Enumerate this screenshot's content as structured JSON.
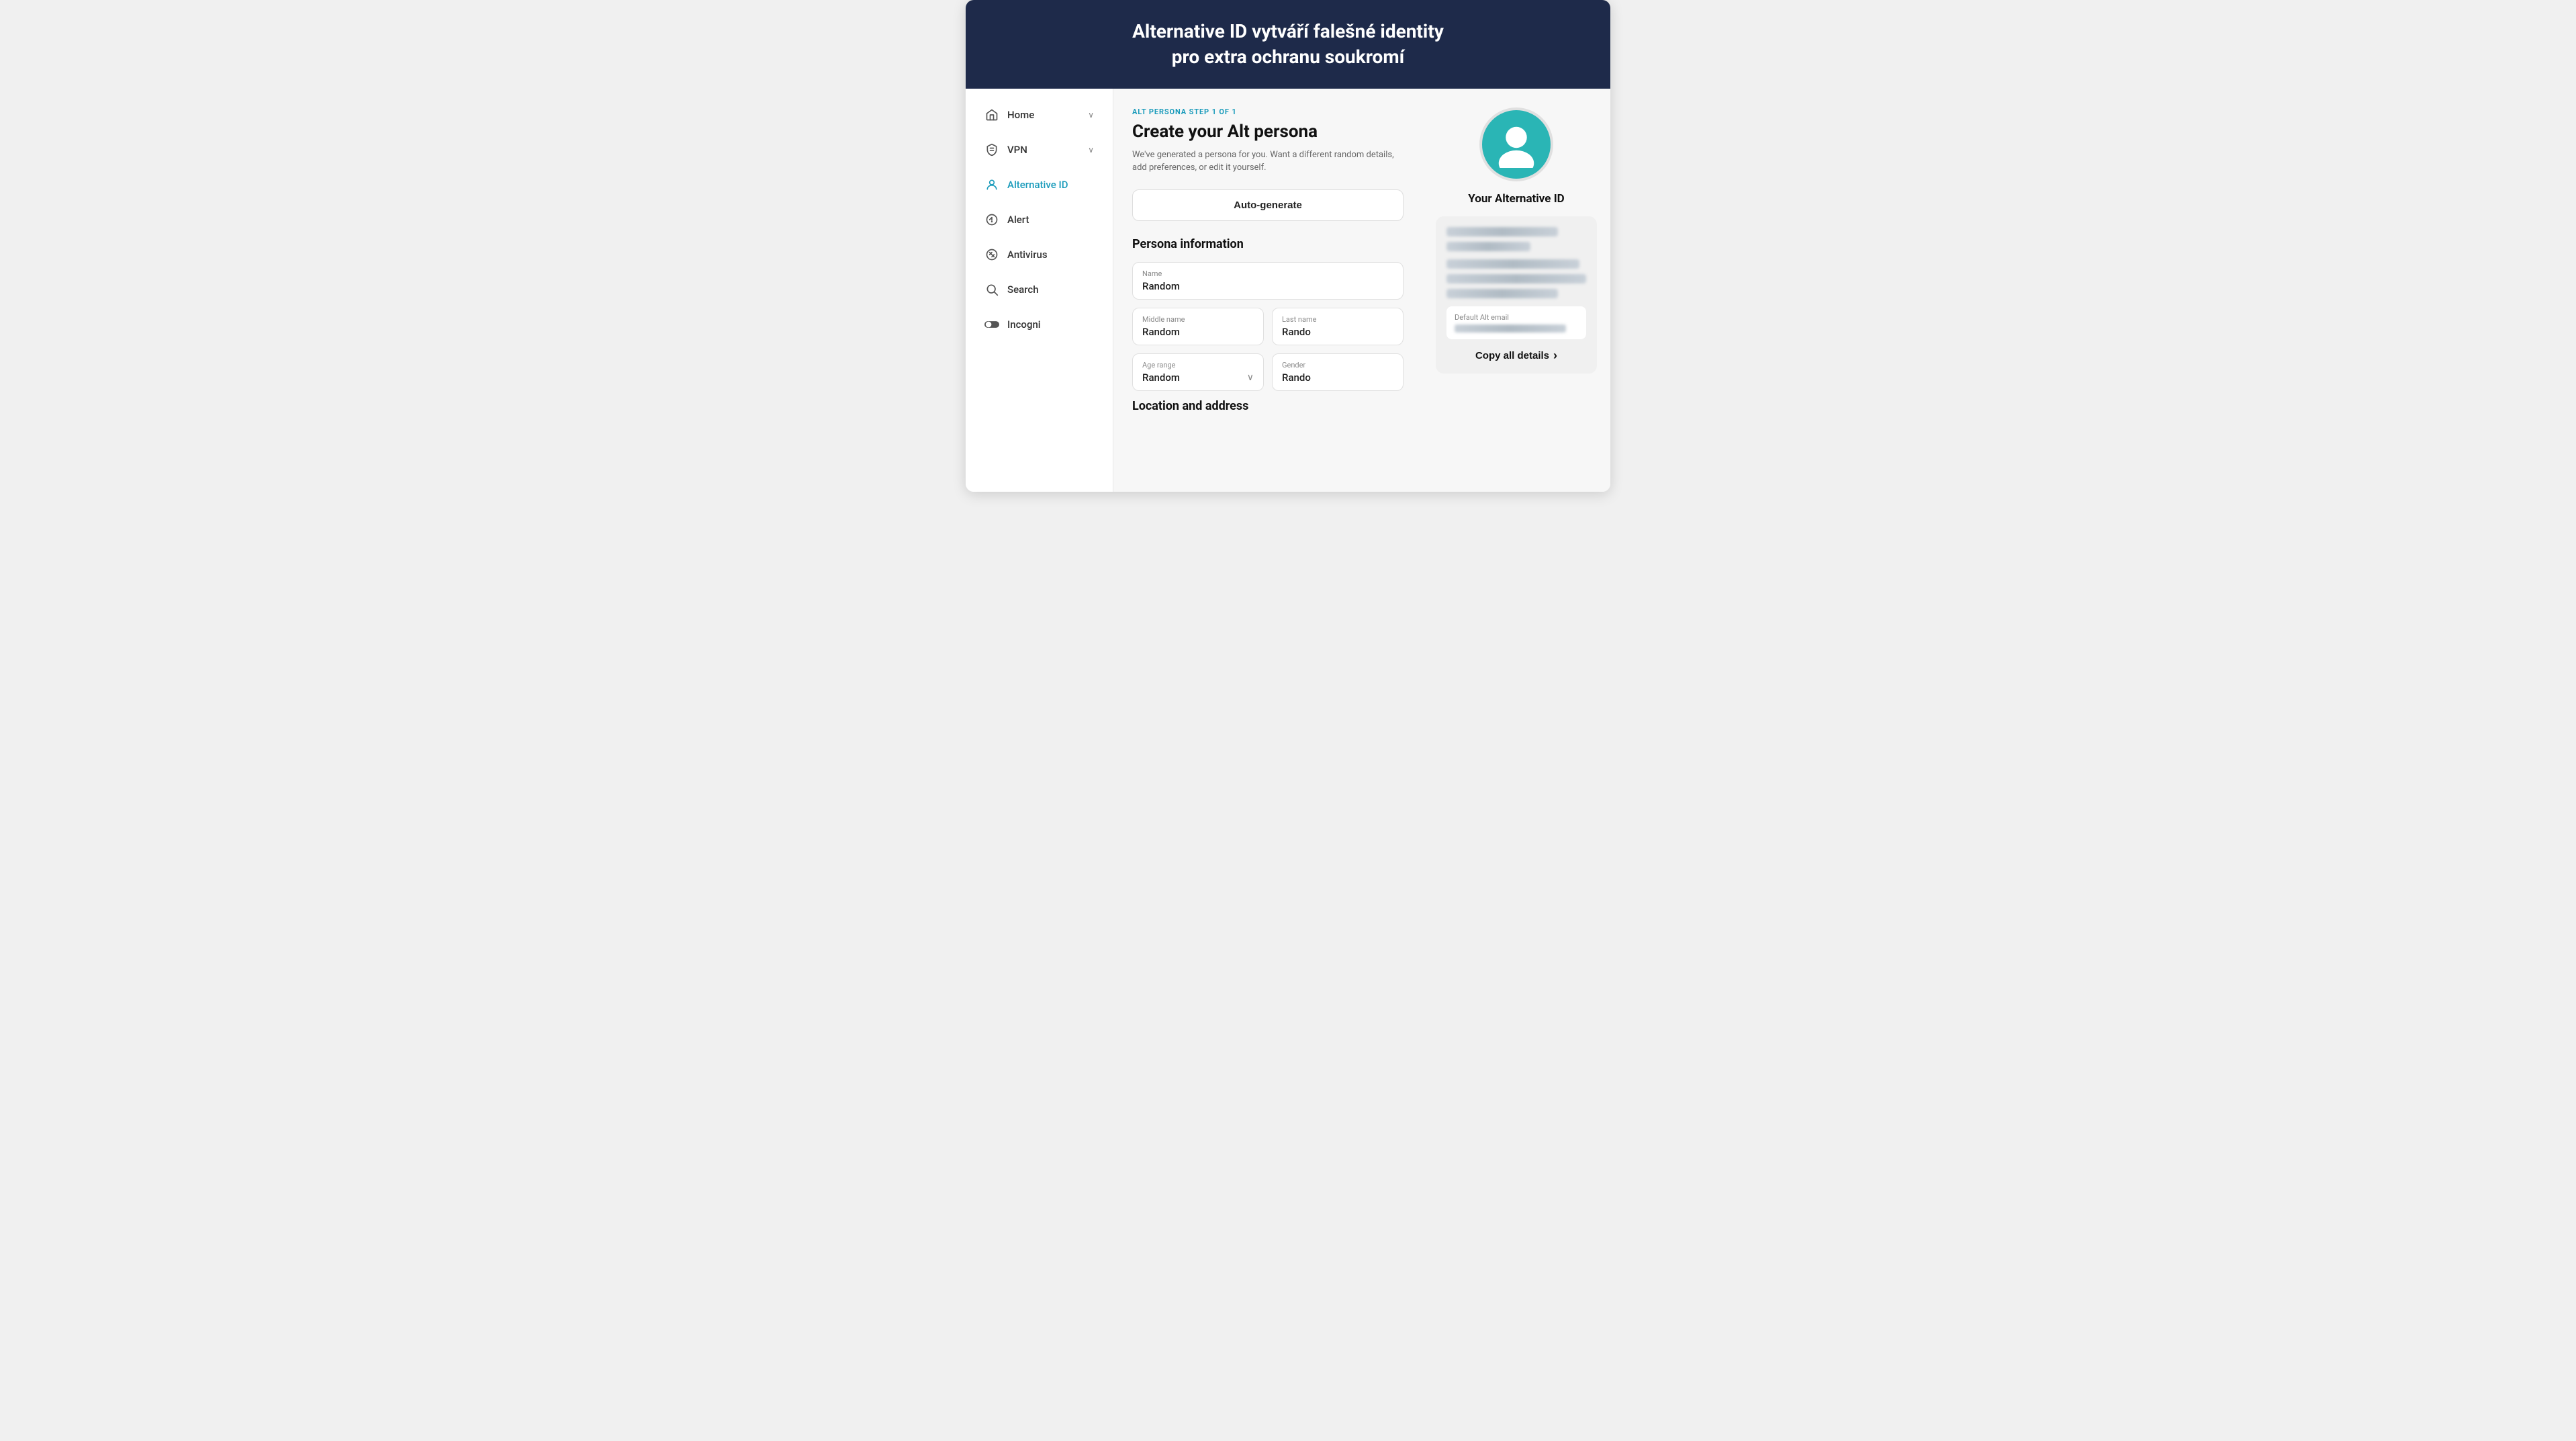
{
  "banner": {
    "text": "Alternative ID vytváří falešné identity\npro extra ochranu soukromí"
  },
  "sidebar": {
    "items": [
      {
        "id": "home",
        "label": "Home",
        "icon": "home",
        "has_chevron": true,
        "active": false
      },
      {
        "id": "vpn",
        "label": "VPN",
        "icon": "shield",
        "has_chevron": true,
        "active": false
      },
      {
        "id": "alternative-id",
        "label": "Alternative ID",
        "icon": "person",
        "has_chevron": false,
        "active": true
      },
      {
        "id": "alert",
        "label": "Alert",
        "icon": "alert",
        "has_chevron": false,
        "active": false
      },
      {
        "id": "antivirus",
        "label": "Antivirus",
        "icon": "antivirus",
        "has_chevron": false,
        "active": false
      },
      {
        "id": "search",
        "label": "Search",
        "icon": "search",
        "has_chevron": false,
        "active": false
      },
      {
        "id": "incogni",
        "label": "Incogni",
        "icon": "toggle",
        "has_chevron": false,
        "active": false
      }
    ]
  },
  "form": {
    "step_label": "ALT PERSONA STEP 1 OF 1",
    "title": "Create your Alt persona",
    "subtitle": "We've generated a persona for you. Want a different random details, add preferences, or edit it yourself.",
    "auto_generate_label": "Auto-generate",
    "persona_section_title": "Persona information",
    "fields": {
      "name_label": "Name",
      "name_value": "Random",
      "middle_name_label": "Middle name",
      "middle_name_value": "Random",
      "last_name_label": "Last name",
      "last_name_value": "Rando",
      "age_range_label": "Age range",
      "age_range_value": "Random",
      "gender_label": "Gender",
      "gender_value": "Rando"
    },
    "location_section_title": "Location and address"
  },
  "right_panel": {
    "alt_id_title": "Your Alternative ID",
    "email_label": "Default Alt email",
    "copy_all_label": "Copy all details",
    "chevron": "›"
  },
  "colors": {
    "accent": "#1a9bbb",
    "banner_bg": "#1e2a4a",
    "active_text": "#1a9bbb",
    "avatar_bg": "#2ab5b5"
  }
}
